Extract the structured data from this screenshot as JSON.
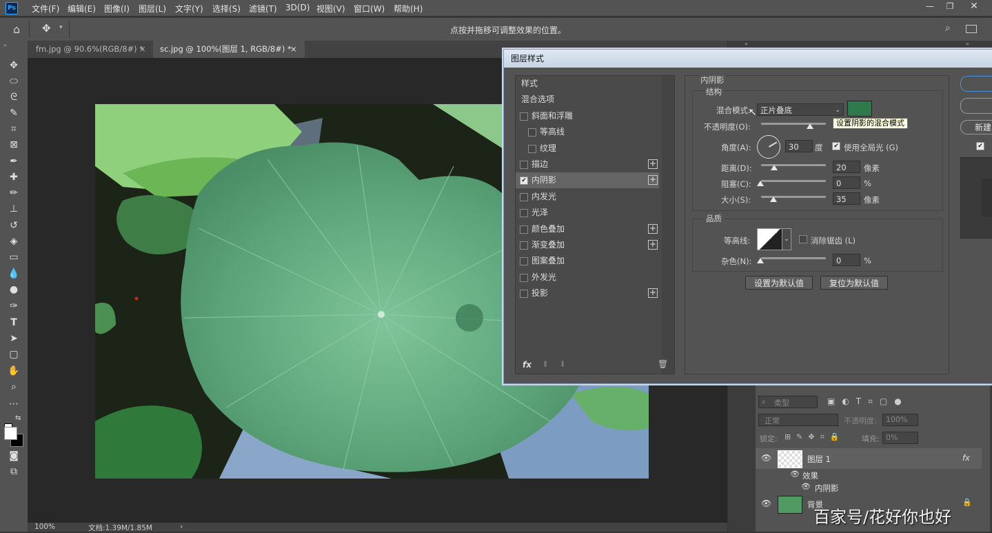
{
  "menubar": {
    "logo": "Ps",
    "items": [
      "文件(F)",
      "编辑(E)",
      "图像(I)",
      "图层(L)",
      "文字(Y)",
      "选择(S)",
      "滤镜(T)",
      "3D(D)",
      "视图(V)",
      "窗口(W)",
      "帮助(H)"
    ]
  },
  "options": {
    "hint": "点按并拖移可调整效果的位置。"
  },
  "tabs": [
    {
      "label": "fm.jpg @ 90.6%(RGB/8#) *",
      "close": "×"
    },
    {
      "label": "sc.jpg @ 100%(图层 1, RGB/8#) *",
      "close": "×"
    }
  ],
  "status": {
    "zoom": "100%",
    "doc": "文档:1.39M/1.85M",
    "arrow": "›"
  },
  "dialog": {
    "title": "图层样式",
    "list": [
      {
        "label": "样式",
        "check": false,
        "plus": false
      },
      {
        "label": "混合选项",
        "check": false,
        "plus": false
      },
      {
        "label": "斜面和浮雕",
        "check": true,
        "checked": false,
        "plus": false
      },
      {
        "label": "等高线",
        "check": true,
        "checked": false,
        "plus": false,
        "indent": true
      },
      {
        "label": "纹理",
        "check": true,
        "checked": false,
        "plus": false,
        "indent": true
      },
      {
        "label": "描边",
        "check": true,
        "checked": false,
        "plus": true
      },
      {
        "label": "内阴影",
        "check": true,
        "checked": true,
        "plus": true,
        "active": true
      },
      {
        "label": "内发光",
        "check": true,
        "checked": false,
        "plus": false
      },
      {
        "label": "光泽",
        "check": true,
        "checked": false,
        "plus": false
      },
      {
        "label": "颜色叠加",
        "check": true,
        "checked": false,
        "plus": true
      },
      {
        "label": "渐变叠加",
        "check": true,
        "checked": false,
        "plus": true
      },
      {
        "label": "图案叠加",
        "check": true,
        "checked": false,
        "plus": false
      },
      {
        "label": "外发光",
        "check": true,
        "checked": false,
        "plus": false
      },
      {
        "label": "投影",
        "check": true,
        "checked": false,
        "plus": true
      }
    ],
    "fx": "fx",
    "section_title": "内阴影",
    "structure": {
      "title": "结构",
      "blend_label": "混合模式:",
      "blend_value": "正片叠底",
      "shadow_color": "#2f7a4c",
      "tooltip": "设置阴影的混合模式",
      "opacity_label": "不透明度(O):",
      "opacity_value": 75,
      "angle_label": "角度(A):",
      "angle_value": "30",
      "angle_unit": "度",
      "global_light": "使用全局光 (G)",
      "distance_label": "距离(D):",
      "distance_value": "20",
      "distance_unit": "像素",
      "choke_label": "阻塞(C):",
      "choke_value": "0",
      "choke_unit": "%",
      "size_label": "大小(S):",
      "size_value": "35",
      "size_unit": "像素"
    },
    "quality": {
      "title": "品质",
      "contour_label": "等高线:",
      "antialias": "消除锯齿 (L)",
      "noise_label": "杂色(N):",
      "noise_value": "0",
      "noise_unit": "%"
    },
    "make_default": "设置为默认值",
    "reset_default": "复位为默认值",
    "right_new": "新建"
  },
  "layers": {
    "filter": "类型",
    "blend": "正常",
    "opacity_label": "不透明度:",
    "opacity_value": "100%",
    "lock_label": "锁定:",
    "fill_label": "填充:",
    "fill_value": "0%",
    "rows": [
      {
        "name": "图层 1",
        "fx": "fx"
      },
      {
        "name": "效果"
      },
      {
        "name": "内阴影"
      },
      {
        "name": "背景"
      }
    ]
  },
  "watermark": "百家号/花好你也好"
}
